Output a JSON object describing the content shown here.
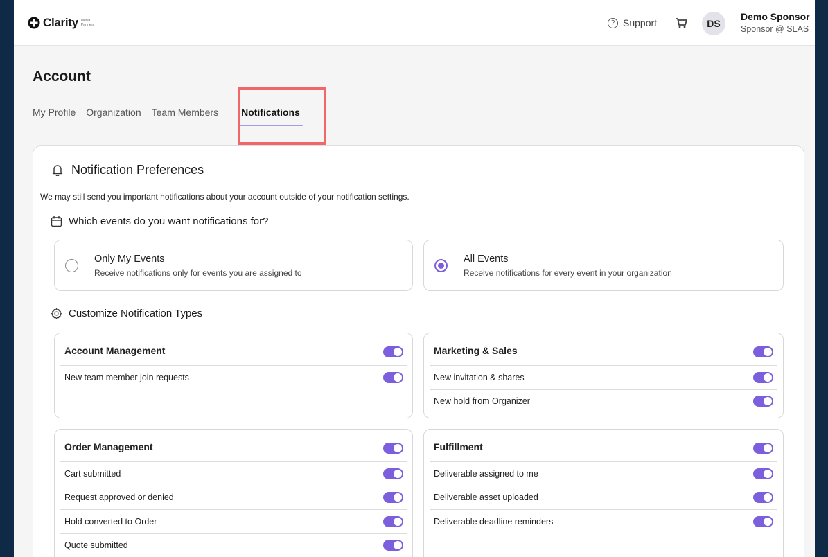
{
  "header": {
    "logo_text": "Clarity",
    "logo_sub": "Media Partners",
    "support_label": "Support",
    "avatar_initials": "DS",
    "user_name": "Demo Sponsor",
    "user_role": "Sponsor @ SLAS"
  },
  "page": {
    "title": "Account",
    "tabs": [
      "My Profile",
      "Organization",
      "Team Members",
      "Notifications"
    ],
    "active_tab": "Notifications"
  },
  "preferences": {
    "title": "Notification Preferences",
    "description": "We may still send you important notifications about your account outside of your notification settings.",
    "events_question": "Which events do you want notifications for?",
    "options": [
      {
        "title": "Only My Events",
        "subtitle": "Receive notifications only for events you are assigned to",
        "selected": false
      },
      {
        "title": "All Events",
        "subtitle": "Receive notifications for every event in your organization",
        "selected": true
      }
    ],
    "customize_title": "Customize Notification Types"
  },
  "groups": {
    "account": {
      "title": "Account Management",
      "enabled": true,
      "items": [
        {
          "label": "New team member join requests",
          "enabled": true
        }
      ]
    },
    "marketing": {
      "title": "Marketing & Sales",
      "enabled": true,
      "items": [
        {
          "label": "New invitation & shares",
          "enabled": true
        },
        {
          "label": "New hold from Organizer",
          "enabled": true
        }
      ]
    },
    "order": {
      "title": "Order Management",
      "enabled": true,
      "items": [
        {
          "label": "Cart submitted",
          "enabled": true
        },
        {
          "label": "Request approved or denied",
          "enabled": true
        },
        {
          "label": "Hold converted to Order",
          "enabled": true
        },
        {
          "label": "Quote submitted",
          "enabled": true
        }
      ]
    },
    "fulfillment": {
      "title": "Fulfillment",
      "enabled": true,
      "items": [
        {
          "label": "Deliverable assigned to me",
          "enabled": true
        },
        {
          "label": "Deliverable asset uploaded",
          "enabled": true
        },
        {
          "label": "Deliverable deadline reminders",
          "enabled": true
        }
      ]
    }
  },
  "colors": {
    "accent": "#7c5fdc",
    "highlight": "#f16767",
    "background": "#0f2a47"
  }
}
